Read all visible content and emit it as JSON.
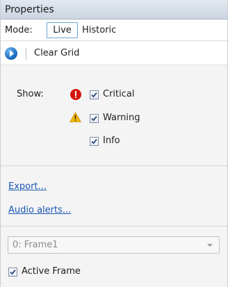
{
  "panel": {
    "title": "Properties"
  },
  "mode": {
    "label": "Mode:",
    "options": [
      "Live",
      "Historic"
    ],
    "selected": "Live"
  },
  "toolbar": {
    "play_icon": "play-circle-icon",
    "clear_grid_label": "Clear Grid"
  },
  "show": {
    "label": "Show:",
    "filters": [
      {
        "label": "Critical",
        "checked": true,
        "icon": "error-icon",
        "icon_color": "#d4160f"
      },
      {
        "label": "Warning",
        "checked": true,
        "icon": "warning-icon",
        "icon_color": "#f2b700"
      },
      {
        "label": "Info",
        "checked": true,
        "icon": "",
        "icon_color": ""
      }
    ]
  },
  "links": {
    "export": "Export...",
    "audio_alerts": "Audio alerts..."
  },
  "frame": {
    "selected": "0: Frame1",
    "active_frame_label": "Active Frame",
    "active_frame_checked": true
  },
  "colors": {
    "link": "#1a55b5",
    "title_bg": "#d5dde7",
    "selected_border": "#6fa6d8"
  }
}
